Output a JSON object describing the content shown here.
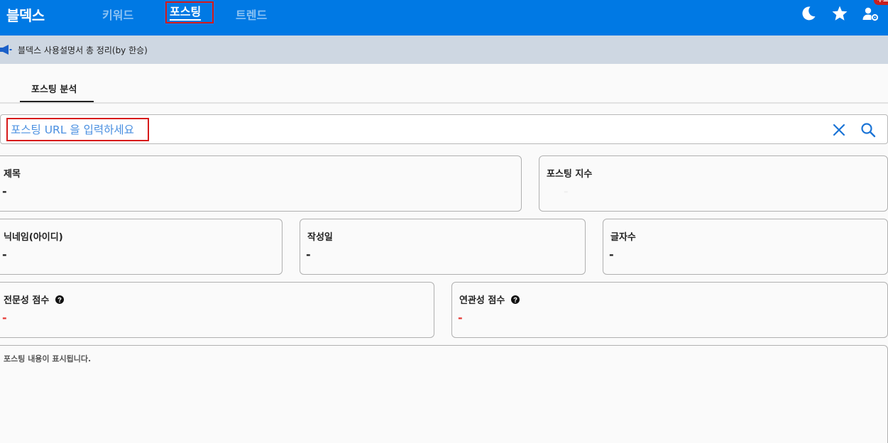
{
  "header": {
    "brand": "블덱스",
    "nav": [
      {
        "label": "키워드"
      },
      {
        "label": "포스팅"
      },
      {
        "label": "트렌드"
      }
    ],
    "badge": "무료"
  },
  "notice": {
    "text": "블덱스 사용설명서 총 정리(by 한승)"
  },
  "tabs": [
    {
      "label": "포스팅 분석"
    }
  ],
  "search": {
    "placeholder": "포스팅 URL 을 입력하세요"
  },
  "cards": {
    "title": {
      "label": "제목",
      "value": "-"
    },
    "index": {
      "label": "포스팅 지수",
      "value": "-"
    },
    "nickname": {
      "label": "닉네임(아이디)",
      "value": "-"
    },
    "date": {
      "label": "작성일",
      "value": "-"
    },
    "chars": {
      "label": "글자수",
      "value": "-"
    },
    "expertise": {
      "label": "전문성 점수",
      "value": "-"
    },
    "relevance": {
      "label": "연관성 점수",
      "value": "-"
    }
  },
  "content": {
    "placeholder": "포스팅 내용이 표시됩니다."
  },
  "colors": {
    "header_bg": "#0079e4",
    "notice_bg": "#ced7e2",
    "highlight_border": "#d71a1a",
    "score_value": "#e53935"
  }
}
